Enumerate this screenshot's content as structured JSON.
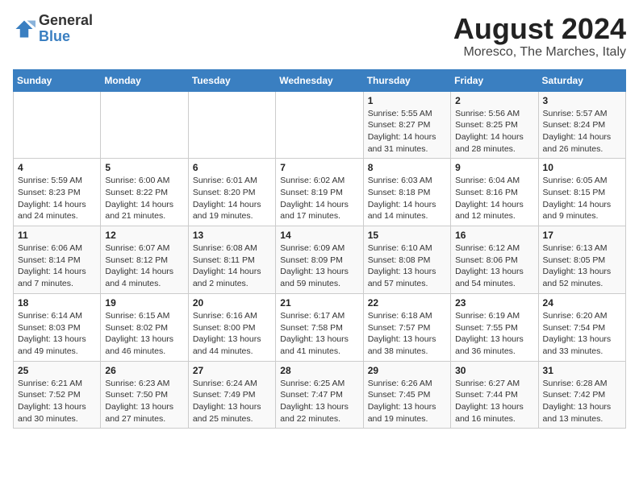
{
  "header": {
    "logo": {
      "general": "General",
      "blue": "Blue"
    },
    "title": "August 2024",
    "location": "Moresco, The Marches, Italy"
  },
  "days_of_week": [
    "Sunday",
    "Monday",
    "Tuesday",
    "Wednesday",
    "Thursday",
    "Friday",
    "Saturday"
  ],
  "weeks": [
    [
      {
        "day": "",
        "info": ""
      },
      {
        "day": "",
        "info": ""
      },
      {
        "day": "",
        "info": ""
      },
      {
        "day": "",
        "info": ""
      },
      {
        "day": "1",
        "info": "Sunrise: 5:55 AM\nSunset: 8:27 PM\nDaylight: 14 hours\nand 31 minutes."
      },
      {
        "day": "2",
        "info": "Sunrise: 5:56 AM\nSunset: 8:25 PM\nDaylight: 14 hours\nand 28 minutes."
      },
      {
        "day": "3",
        "info": "Sunrise: 5:57 AM\nSunset: 8:24 PM\nDaylight: 14 hours\nand 26 minutes."
      }
    ],
    [
      {
        "day": "4",
        "info": "Sunrise: 5:59 AM\nSunset: 8:23 PM\nDaylight: 14 hours\nand 24 minutes."
      },
      {
        "day": "5",
        "info": "Sunrise: 6:00 AM\nSunset: 8:22 PM\nDaylight: 14 hours\nand 21 minutes."
      },
      {
        "day": "6",
        "info": "Sunrise: 6:01 AM\nSunset: 8:20 PM\nDaylight: 14 hours\nand 19 minutes."
      },
      {
        "day": "7",
        "info": "Sunrise: 6:02 AM\nSunset: 8:19 PM\nDaylight: 14 hours\nand 17 minutes."
      },
      {
        "day": "8",
        "info": "Sunrise: 6:03 AM\nSunset: 8:18 PM\nDaylight: 14 hours\nand 14 minutes."
      },
      {
        "day": "9",
        "info": "Sunrise: 6:04 AM\nSunset: 8:16 PM\nDaylight: 14 hours\nand 12 minutes."
      },
      {
        "day": "10",
        "info": "Sunrise: 6:05 AM\nSunset: 8:15 PM\nDaylight: 14 hours\nand 9 minutes."
      }
    ],
    [
      {
        "day": "11",
        "info": "Sunrise: 6:06 AM\nSunset: 8:14 PM\nDaylight: 14 hours\nand 7 minutes."
      },
      {
        "day": "12",
        "info": "Sunrise: 6:07 AM\nSunset: 8:12 PM\nDaylight: 14 hours\nand 4 minutes."
      },
      {
        "day": "13",
        "info": "Sunrise: 6:08 AM\nSunset: 8:11 PM\nDaylight: 14 hours\nand 2 minutes."
      },
      {
        "day": "14",
        "info": "Sunrise: 6:09 AM\nSunset: 8:09 PM\nDaylight: 13 hours\nand 59 minutes."
      },
      {
        "day": "15",
        "info": "Sunrise: 6:10 AM\nSunset: 8:08 PM\nDaylight: 13 hours\nand 57 minutes."
      },
      {
        "day": "16",
        "info": "Sunrise: 6:12 AM\nSunset: 8:06 PM\nDaylight: 13 hours\nand 54 minutes."
      },
      {
        "day": "17",
        "info": "Sunrise: 6:13 AM\nSunset: 8:05 PM\nDaylight: 13 hours\nand 52 minutes."
      }
    ],
    [
      {
        "day": "18",
        "info": "Sunrise: 6:14 AM\nSunset: 8:03 PM\nDaylight: 13 hours\nand 49 minutes."
      },
      {
        "day": "19",
        "info": "Sunrise: 6:15 AM\nSunset: 8:02 PM\nDaylight: 13 hours\nand 46 minutes."
      },
      {
        "day": "20",
        "info": "Sunrise: 6:16 AM\nSunset: 8:00 PM\nDaylight: 13 hours\nand 44 minutes."
      },
      {
        "day": "21",
        "info": "Sunrise: 6:17 AM\nSunset: 7:58 PM\nDaylight: 13 hours\nand 41 minutes."
      },
      {
        "day": "22",
        "info": "Sunrise: 6:18 AM\nSunset: 7:57 PM\nDaylight: 13 hours\nand 38 minutes."
      },
      {
        "day": "23",
        "info": "Sunrise: 6:19 AM\nSunset: 7:55 PM\nDaylight: 13 hours\nand 36 minutes."
      },
      {
        "day": "24",
        "info": "Sunrise: 6:20 AM\nSunset: 7:54 PM\nDaylight: 13 hours\nand 33 minutes."
      }
    ],
    [
      {
        "day": "25",
        "info": "Sunrise: 6:21 AM\nSunset: 7:52 PM\nDaylight: 13 hours\nand 30 minutes."
      },
      {
        "day": "26",
        "info": "Sunrise: 6:23 AM\nSunset: 7:50 PM\nDaylight: 13 hours\nand 27 minutes."
      },
      {
        "day": "27",
        "info": "Sunrise: 6:24 AM\nSunset: 7:49 PM\nDaylight: 13 hours\nand 25 minutes."
      },
      {
        "day": "28",
        "info": "Sunrise: 6:25 AM\nSunset: 7:47 PM\nDaylight: 13 hours\nand 22 minutes."
      },
      {
        "day": "29",
        "info": "Sunrise: 6:26 AM\nSunset: 7:45 PM\nDaylight: 13 hours\nand 19 minutes."
      },
      {
        "day": "30",
        "info": "Sunrise: 6:27 AM\nSunset: 7:44 PM\nDaylight: 13 hours\nand 16 minutes."
      },
      {
        "day": "31",
        "info": "Sunrise: 6:28 AM\nSunset: 7:42 PM\nDaylight: 13 hours\nand 13 minutes."
      }
    ]
  ]
}
